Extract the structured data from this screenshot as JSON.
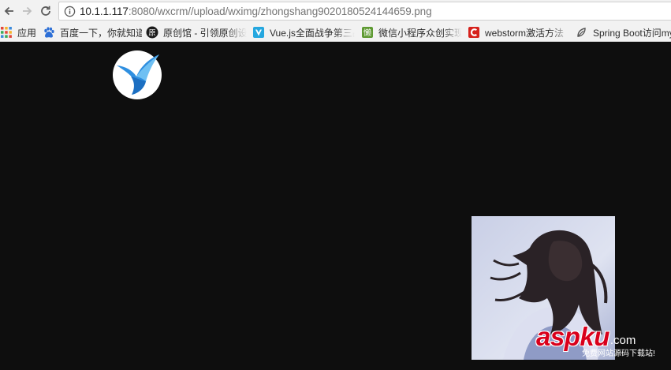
{
  "toolbar": {
    "back_icon": "back-arrow-icon",
    "forward_icon": "forward-arrow-icon",
    "reload_icon": "reload-icon",
    "info_icon": "info-icon",
    "url_host": "10.1.1.117",
    "url_rest": ":8080/wxcrm//upload/wximg/zhongshang9020180524144659.png"
  },
  "bookmarks": {
    "items": [
      {
        "label": "应用",
        "icon": "apps-grid-icon"
      },
      {
        "label": "百度一下，你就知道",
        "icon": "baidu-paw-icon"
      },
      {
        "label": "原创馆 - 引领原创设计",
        "icon": "yuanchuang-icon"
      },
      {
        "label": "Vue.js全面战争第三战",
        "icon": "vue-bookmark-icon"
      },
      {
        "label": "微信小程序众创实现",
        "icon": "weixin-app-icon"
      },
      {
        "label": "webstorm激活方法",
        "icon": "csdn-c-icon"
      },
      {
        "label": "Spring Boot访问my",
        "icon": "spring-leaf-icon"
      }
    ]
  },
  "page": {
    "logo_icon": "bird-logo-icon",
    "photo": "girl-portrait-image",
    "watermark_main": "aspku",
    "watermark_tld": ".com",
    "watermark_tagline": "免费网站源码下载站!"
  },
  "colors": {
    "page_bg": "#0e0e0e",
    "chrome_bg": "#f2f2f2",
    "watermark_red": "#d9001b",
    "bird_blue": "#2f8fe0"
  }
}
